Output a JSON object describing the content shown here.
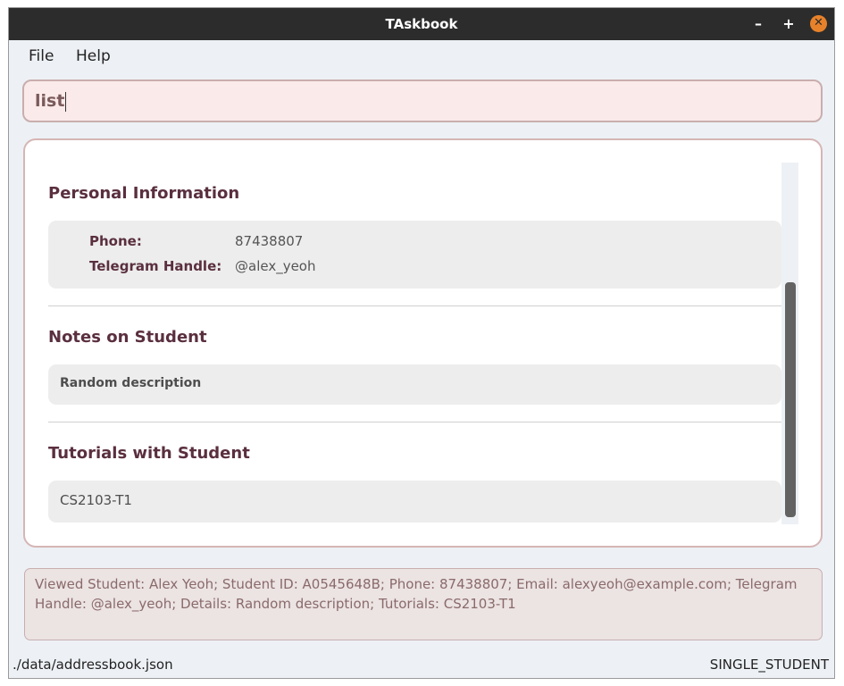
{
  "window": {
    "title": "TAskbook",
    "minimize": "–",
    "maximize": "+",
    "close": "✕"
  },
  "menu": {
    "file": "File",
    "help": "Help"
  },
  "command": {
    "value": "list"
  },
  "details": {
    "personal": {
      "title": "Personal Information",
      "phone_label": "Phone:",
      "phone_value": "87438807",
      "telegram_label": "Telegram Handle:",
      "telegram_value": "@alex_yeoh"
    },
    "notes": {
      "title": "Notes on Student",
      "text": "Random description"
    },
    "tutorials": {
      "title": "Tutorials with Student",
      "items": [
        "CS2103-T1"
      ]
    }
  },
  "result": {
    "text": "Viewed Student: Alex Yeoh; Student ID: A0545648B; Phone: 87438807; Email: alexyeoh@example.com; Telegram Handle: @alex_yeoh; Details: Random description; Tutorials: CS2103-T1"
  },
  "status": {
    "path": "./data/addressbook.json",
    "mode": "SINGLE_STUDENT"
  },
  "colors": {
    "accent": "#5a2f3f",
    "close_button": "#e8822a",
    "titlebar": "#2c2c2c",
    "command_bg": "#fbeaea"
  },
  "icons": {
    "minimize": "minimize-icon",
    "maximize": "maximize-icon",
    "close": "close-icon"
  }
}
